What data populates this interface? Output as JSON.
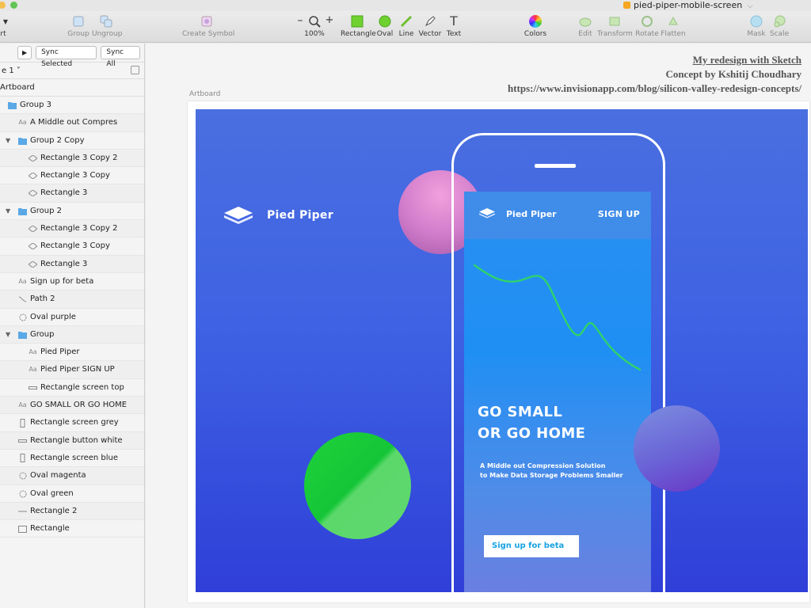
{
  "window": {
    "title": "pied-piper-mobile-screen",
    "title_suffix": "⌵"
  },
  "toolbar": {
    "partial_left": "rt",
    "group": "Group",
    "ungroup": "Ungroup",
    "create_symbol": "Create Symbol",
    "zoom_minus": "–",
    "zoom_plus": "+",
    "zoom": "100%",
    "rectangle": "Rectangle",
    "oval": "Oval",
    "line": "Line",
    "vector": "Vector",
    "text": "Text",
    "colors": "Colors",
    "edit": "Edit",
    "transform": "Transform",
    "rotate": "Rotate",
    "flatten": "Flatten",
    "mask": "Mask",
    "scale": "Scale"
  },
  "sidebar": {
    "sync_selected": "Sync Selected",
    "sync_all": "Sync All",
    "page": "e 1 ˅",
    "artboard": "Artboard",
    "layers": [
      {
        "label": "Group 3",
        "kind": "group",
        "indent": 0,
        "expanded": true
      },
      {
        "label": "A Middle out Compres",
        "kind": "text",
        "indent": 1
      },
      {
        "label": "Group 2 Copy",
        "kind": "group",
        "indent": 1,
        "expanded": true
      },
      {
        "label": "Rectangle 3 Copy 2",
        "kind": "shape",
        "indent": 2
      },
      {
        "label": "Rectangle 3 Copy",
        "kind": "shape",
        "indent": 2
      },
      {
        "label": "Rectangle 3",
        "kind": "shape",
        "indent": 2
      },
      {
        "label": "Group 2",
        "kind": "group",
        "indent": 1,
        "expanded": true
      },
      {
        "label": "Rectangle 3 Copy 2",
        "kind": "shape",
        "indent": 2
      },
      {
        "label": "Rectangle 3 Copy",
        "kind": "shape",
        "indent": 2
      },
      {
        "label": "Rectangle 3",
        "kind": "shape",
        "indent": 2
      },
      {
        "label": "Sign up for beta",
        "kind": "text",
        "indent": 1
      },
      {
        "label": "Path 2",
        "kind": "path",
        "indent": 1
      },
      {
        "label": "Oval purple",
        "kind": "oval",
        "indent": 1
      },
      {
        "label": "Group",
        "kind": "group",
        "indent": 1,
        "expanded": true
      },
      {
        "label": "Pied Piper",
        "kind": "text",
        "indent": 2
      },
      {
        "label": "Pied Piper SIGN UP",
        "kind": "text",
        "indent": 2
      },
      {
        "label": "Rectangle screen top",
        "kind": "hrect",
        "indent": 2
      },
      {
        "label": "GO SMALL OR GO HOME",
        "kind": "text",
        "indent": 1
      },
      {
        "label": "Rectangle screen grey",
        "kind": "vrect",
        "indent": 1
      },
      {
        "label": "Rectangle button white",
        "kind": "hrect",
        "indent": 1
      },
      {
        "label": "Rectangle screen blue",
        "kind": "vrect",
        "indent": 1
      },
      {
        "label": "Oval magenta",
        "kind": "oval",
        "indent": 1
      },
      {
        "label": "Oval green",
        "kind": "oval",
        "indent": 1
      },
      {
        "label": "Rectangle 2",
        "kind": "line",
        "indent": 1
      },
      {
        "label": "Rectangle",
        "kind": "rect",
        "indent": 1
      }
    ]
  },
  "canvas": {
    "credit_line1": "My redesign with Sketch",
    "credit_line2": "Concept by Kshitij Choudhary",
    "credit_line3": "https://www.invisionapp.com/blog/silicon-valley-redesign-concepts/",
    "artboard_label": "Artboard",
    "brand": "Pied Piper",
    "screen": {
      "brand": "Pied Piper",
      "signup": "SIGN UP",
      "headline1": "GO SMALL",
      "headline2": "OR GO HOME",
      "sub1": "A Middle out Compression Solution",
      "sub2": "to Make Data Storage Problems Smaller",
      "cta": "Sign up for beta"
    }
  },
  "colors": {
    "artboard_blue": "#3e62e3",
    "screen_blue": "#1f8ff4",
    "wave_green": "#2fd36b",
    "oval_green": "#14c637",
    "oval_magenta": "#d07ccb",
    "oval_purple": "#6a63d6",
    "cta_text": "#17a2e3"
  }
}
